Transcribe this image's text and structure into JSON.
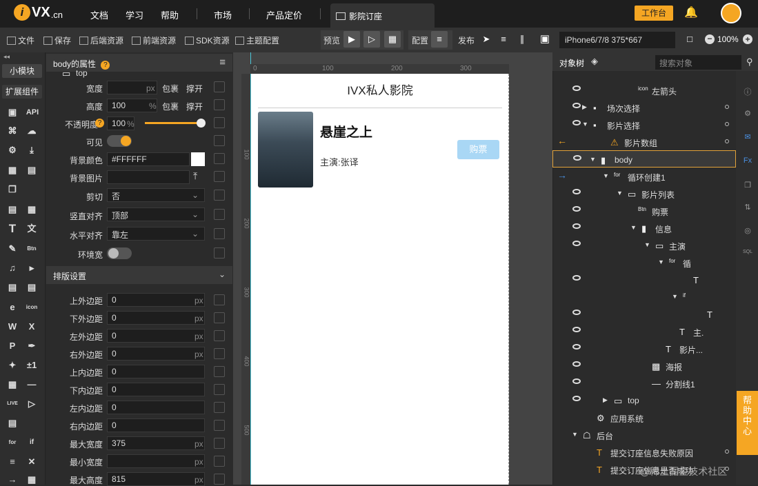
{
  "topbar": {
    "logo_text": "VX",
    "logo_suffix": ".cn",
    "nav": [
      "文档",
      "学习",
      "帮助",
      "市场",
      "产品定价"
    ],
    "tab_label": "影院订座",
    "workbench": "工作台"
  },
  "toolbar": {
    "items": [
      "文件",
      "保存",
      "后端资源",
      "前端资源",
      "SDK资源",
      "主题配置"
    ],
    "preview": "预览",
    "config": "配置",
    "publish": "发布",
    "device": "iPhone6/7/8 375*667",
    "zoom": "100%"
  },
  "left": {
    "small_module": "小模块",
    "ext_component": "扩展组件",
    "api": "API"
  },
  "props": {
    "header": "body的属性",
    "rows": [
      {
        "label": "宽度",
        "value": "",
        "unit": "px",
        "a": "包裹",
        "b": "撑开"
      },
      {
        "label": "高度",
        "value": "100",
        "unit": "%",
        "a": "包裹",
        "b": "撑开"
      },
      {
        "label": "不透明度",
        "value": "100",
        "unit": "%"
      },
      {
        "label": "可见"
      },
      {
        "label": "背景颜色",
        "value": "#FFFFFF"
      },
      {
        "label": "背景图片"
      },
      {
        "label": "剪切",
        "value": "否"
      },
      {
        "label": "竖直对齐",
        "value": "顶部"
      },
      {
        "label": "水平对齐",
        "value": "靠左"
      },
      {
        "label": "环境宽"
      }
    ],
    "layout_header": "排版设置",
    "layout_rows": [
      {
        "label": "上外边距",
        "value": "0",
        "unit": "px"
      },
      {
        "label": "下外边距",
        "value": "0",
        "unit": "px"
      },
      {
        "label": "左外边距",
        "value": "0",
        "unit": "px"
      },
      {
        "label": "右外边距",
        "value": "0",
        "unit": "px"
      },
      {
        "label": "上内边距",
        "value": "0",
        "unit": ""
      },
      {
        "label": "下内边距",
        "value": "0",
        "unit": ""
      },
      {
        "label": "左内边距",
        "value": "0",
        "unit": ""
      },
      {
        "label": "右内边距",
        "value": "0",
        "unit": ""
      },
      {
        "label": "最大宽度",
        "value": "375",
        "unit": "px"
      },
      {
        "label": "最小宽度",
        "value": "",
        "unit": "px"
      },
      {
        "label": "最大高度",
        "value": "815",
        "unit": "px"
      }
    ]
  },
  "canvas": {
    "ruler": [
      "0",
      "100",
      "200",
      "300"
    ],
    "vruler": [
      "100",
      "200",
      "300",
      "400",
      "500"
    ],
    "app_title": "IVX私人影院",
    "movie_title": "悬崖之上",
    "movie_cast": "主演:张译",
    "buy": "购票"
  },
  "tree": {
    "header": "对象树",
    "search_placeholder": "搜索对象",
    "rows": [
      {
        "text": "top"
      },
      {
        "text": "左箭头"
      },
      {
        "text": "场次选择"
      },
      {
        "text": "影片选择"
      },
      {
        "text": "影片数组"
      },
      {
        "text": "body"
      },
      {
        "text": "循环创建1"
      },
      {
        "text": "影片列表"
      },
      {
        "text": "购票"
      },
      {
        "text": "信息"
      },
      {
        "text": "主演"
      },
      {
        "text": "循"
      },
      {
        "text": ""
      },
      {
        "text": ""
      },
      {
        "text": ""
      },
      {
        "text": "主."
      },
      {
        "text": "影片..."
      },
      {
        "text": "海报"
      },
      {
        "text": "分割线1"
      },
      {
        "text": "top"
      },
      {
        "text": "应用系统"
      },
      {
        "text": "后台"
      },
      {
        "text": "提交订座信息失败原因"
      },
      {
        "text": "提交订座信息是否成功"
      }
    ]
  },
  "help": "帮助中心",
  "watermark": "@稀土掘金技术社区",
  "colors": {
    "accent": "#f5a623",
    "selection": "#e3a33a"
  }
}
